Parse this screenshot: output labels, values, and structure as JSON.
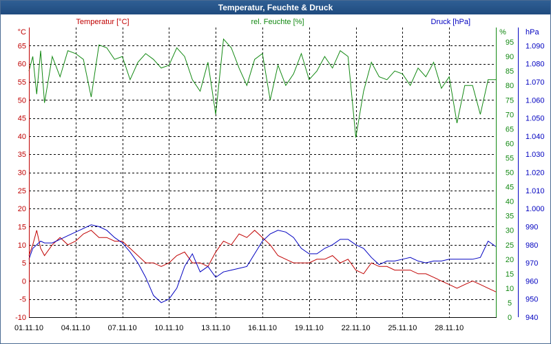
{
  "window": {
    "title": "Temperatur, Feuchte & Druck"
  },
  "colors": {
    "temperature": "#c00000",
    "humidity": "#118811",
    "pressure": "#0000c0",
    "axis": "#000000",
    "grid": "#000000"
  },
  "chart_data": {
    "type": "line",
    "title": "Temperatur, Feuchte & Druck",
    "grid": true,
    "x": {
      "range": [
        "2010-11-01",
        "2010-12-01"
      ],
      "tick_labels": [
        "01.11.10",
        "04.11.10",
        "07.11.10",
        "10.11.10",
        "13.11.10",
        "16.11.10",
        "19.11.10",
        "22.11.10",
        "25.11.10",
        "28.11.10"
      ]
    },
    "axes": {
      "temperature": {
        "label": "Temperatur [°C]",
        "unit": "°C",
        "range": [
          -10,
          70
        ],
        "tick_labels": [
          "-10",
          "-5",
          "0",
          "5",
          "10",
          "15",
          "20",
          "25",
          "30",
          "35",
          "40",
          "45",
          "50",
          "55",
          "60",
          "65"
        ]
      },
      "humidity": {
        "label": "rel. Feuchte [%]",
        "unit": "%",
        "range": [
          0,
          100
        ],
        "tick_labels": [
          "0",
          "5",
          "10",
          "15",
          "20",
          "25",
          "30",
          "35",
          "40",
          "45",
          "50",
          "55",
          "60",
          "65",
          "70",
          "75",
          "80",
          "85",
          "90",
          "95"
        ]
      },
      "pressure": {
        "label": "Druck [hPa]",
        "unit": "hPa",
        "range": [
          940,
          1100
        ],
        "tick_labels": [
          "940",
          "950",
          "960",
          "970",
          "980",
          "990",
          "1.000",
          "1.010",
          "1.020",
          "1.030",
          "1.040",
          "1.050",
          "1.060",
          "1.070",
          "1.080",
          "1.090"
        ]
      }
    },
    "series": [
      {
        "name": "Temperatur [°C]",
        "axis": "temperature",
        "x": [
          "2010-11-01",
          "2010-11-01 06:00",
          "2010-11-01 12:00",
          "2010-11-01 18:00",
          "2010-11-02",
          "2010-11-02 12:00",
          "2010-11-03",
          "2010-11-03 12:00",
          "2010-11-04",
          "2010-11-04 12:00",
          "2010-11-05",
          "2010-11-05 12:00",
          "2010-11-06",
          "2010-11-06 12:00",
          "2010-11-07",
          "2010-11-07 12:00",
          "2010-11-08",
          "2010-11-08 12:00",
          "2010-11-09",
          "2010-11-09 12:00",
          "2010-11-10",
          "2010-11-10 12:00",
          "2010-11-11",
          "2010-11-11 12:00",
          "2010-11-12",
          "2010-11-12 12:00",
          "2010-11-13",
          "2010-11-13 12:00",
          "2010-11-14",
          "2010-11-14 12:00",
          "2010-11-15",
          "2010-11-15 12:00",
          "2010-11-16",
          "2010-11-16 12:00",
          "2010-11-17",
          "2010-11-17 12:00",
          "2010-11-18",
          "2010-11-18 12:00",
          "2010-11-19",
          "2010-11-19 12:00",
          "2010-11-20",
          "2010-11-20 12:00",
          "2010-11-21",
          "2010-11-21 12:00",
          "2010-11-22",
          "2010-11-22 12:00",
          "2010-11-23",
          "2010-11-23 12:00",
          "2010-11-24",
          "2010-11-24 12:00",
          "2010-11-25",
          "2010-11-25 12:00",
          "2010-11-26",
          "2010-11-26 12:00",
          "2010-11-27",
          "2010-11-27 12:00",
          "2010-11-28",
          "2010-11-28 12:00",
          "2010-11-29",
          "2010-11-29 12:00",
          "2010-11-30",
          "2010-11-30 12:00",
          "2010-12-01"
        ],
        "values": [
          7,
          10,
          14,
          9,
          7,
          10,
          12,
          10,
          11,
          13,
          14,
          12,
          12,
          11,
          11,
          9,
          7,
          5,
          5,
          4,
          5,
          7,
          8,
          5,
          5,
          4,
          8,
          11,
          10,
          13,
          12,
          14,
          12,
          10,
          7,
          6,
          5,
          5,
          5,
          6,
          6,
          7,
          5,
          6,
          3,
          2,
          5,
          4,
          4,
          3,
          3,
          3,
          2,
          2,
          1,
          0,
          -1,
          -2,
          -1,
          0,
          -1,
          -2,
          -3
        ]
      },
      {
        "name": "rel. Feuchte [%]",
        "axis": "humidity",
        "x": [
          "2010-11-01",
          "2010-11-01 06:00",
          "2010-11-01 12:00",
          "2010-11-01 18:00",
          "2010-11-02",
          "2010-11-02 12:00",
          "2010-11-03",
          "2010-11-03 12:00",
          "2010-11-04",
          "2010-11-04 12:00",
          "2010-11-05",
          "2010-11-05 12:00",
          "2010-11-06",
          "2010-11-06 12:00",
          "2010-11-07",
          "2010-11-07 12:00",
          "2010-11-08",
          "2010-11-08 12:00",
          "2010-11-09",
          "2010-11-09 12:00",
          "2010-11-10",
          "2010-11-10 12:00",
          "2010-11-11",
          "2010-11-11 12:00",
          "2010-11-12",
          "2010-11-12 12:00",
          "2010-11-13",
          "2010-11-13 12:00",
          "2010-11-14",
          "2010-11-14 12:00",
          "2010-11-15",
          "2010-11-15 12:00",
          "2010-11-16",
          "2010-11-16 12:00",
          "2010-11-17",
          "2010-11-17 12:00",
          "2010-11-18",
          "2010-11-18 12:00",
          "2010-11-19",
          "2010-11-19 12:00",
          "2010-11-20",
          "2010-11-20 12:00",
          "2010-11-21",
          "2010-11-21 12:00",
          "2010-11-22",
          "2010-11-22 12:00",
          "2010-11-23",
          "2010-11-23 12:00",
          "2010-11-24",
          "2010-11-24 12:00",
          "2010-11-25",
          "2010-11-25 12:00",
          "2010-11-26",
          "2010-11-26 12:00",
          "2010-11-27",
          "2010-11-27 12:00",
          "2010-11-28",
          "2010-11-28 12:00",
          "2010-11-29",
          "2010-11-29 12:00",
          "2010-11-30",
          "2010-11-30 12:00",
          "2010-12-01"
        ],
        "values": [
          85,
          90,
          77,
          92,
          74,
          90,
          83,
          92,
          91,
          89,
          76,
          94,
          93,
          89,
          90,
          82,
          88,
          91,
          89,
          86,
          87,
          93,
          90,
          82,
          78,
          88,
          70,
          96,
          93,
          86,
          80,
          89,
          91,
          75,
          87,
          80,
          84,
          91,
          82,
          85,
          90,
          86,
          92,
          90,
          62,
          78,
          88,
          83,
          82,
          85,
          84,
          80,
          86,
          83,
          88,
          79,
          83,
          67,
          80,
          80,
          70,
          82,
          82
        ]
      },
      {
        "name": "Druck [hPa]",
        "axis": "pressure",
        "x": [
          "2010-11-01",
          "2010-11-01 06:00",
          "2010-11-01 12:00",
          "2010-11-01 18:00",
          "2010-11-02",
          "2010-11-02 12:00",
          "2010-11-03",
          "2010-11-03 12:00",
          "2010-11-04",
          "2010-11-04 12:00",
          "2010-11-05",
          "2010-11-05 12:00",
          "2010-11-06",
          "2010-11-06 12:00",
          "2010-11-07",
          "2010-11-07 12:00",
          "2010-11-08",
          "2010-11-08 12:00",
          "2010-11-09",
          "2010-11-09 12:00",
          "2010-11-10",
          "2010-11-10 12:00",
          "2010-11-11",
          "2010-11-11 12:00",
          "2010-11-12",
          "2010-11-12 12:00",
          "2010-11-13",
          "2010-11-13 12:00",
          "2010-11-14",
          "2010-11-14 12:00",
          "2010-11-15",
          "2010-11-15 12:00",
          "2010-11-16",
          "2010-11-16 12:00",
          "2010-11-17",
          "2010-11-17 12:00",
          "2010-11-18",
          "2010-11-18 12:00",
          "2010-11-19",
          "2010-11-19 12:00",
          "2010-11-20",
          "2010-11-20 12:00",
          "2010-11-21",
          "2010-11-21 12:00",
          "2010-11-22",
          "2010-11-22 12:00",
          "2010-11-23",
          "2010-11-23 12:00",
          "2010-11-24",
          "2010-11-24 12:00",
          "2010-11-25",
          "2010-11-25 12:00",
          "2010-11-26",
          "2010-11-26 12:00",
          "2010-11-27",
          "2010-11-27 12:00",
          "2010-11-28",
          "2010-11-28 12:00",
          "2010-11-29",
          "2010-11-29 12:00",
          "2010-11-30",
          "2010-11-30 12:00",
          "2010-12-01"
        ],
        "values": [
          972,
          978,
          980,
          982,
          981,
          981,
          983,
          985,
          987,
          989,
          991,
          990,
          988,
          984,
          981,
          976,
          970,
          962,
          952,
          948,
          950,
          956,
          968,
          975,
          965,
          968,
          962,
          965,
          966,
          967,
          968,
          975,
          982,
          986,
          988,
          987,
          984,
          978,
          975,
          975,
          978,
          980,
          983,
          983,
          980,
          978,
          973,
          969,
          971,
          971,
          972,
          973,
          971,
          970,
          971,
          971,
          972,
          972,
          972,
          972,
          973,
          982,
          979
        ]
      }
    ]
  }
}
